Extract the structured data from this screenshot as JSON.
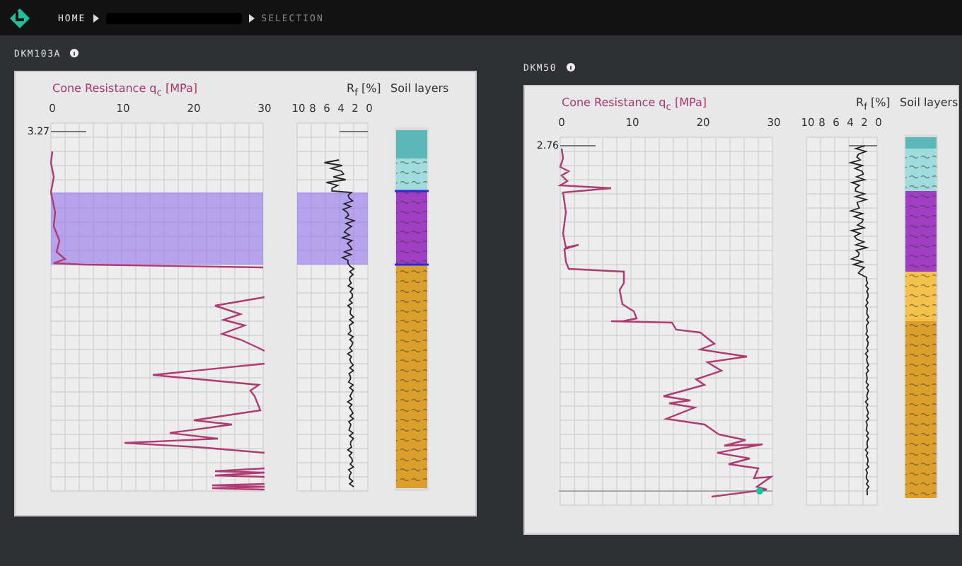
{
  "header": {
    "breadcrumbs": [
      {
        "kind": "link",
        "label": "HOME"
      },
      {
        "kind": "redacted"
      },
      {
        "kind": "current",
        "label": "SELECTION"
      }
    ]
  },
  "panels": [
    {
      "name": "DKM103A",
      "qc_title": "Cone Resistance q$_{c}$ [MPa]",
      "qc_ticks": [
        "0",
        "10",
        "20",
        "30"
      ],
      "rf_title": "R$_{f}$ [%]",
      "rf_ticks": [
        "10",
        "8",
        "6",
        "4",
        "2",
        "0"
      ],
      "soil_title": "Soil layers",
      "depth": "3.27",
      "highlighted": true,
      "cursor": false,
      "layers": [
        {
          "color": "#5cb8b8",
          "patterned": false
        },
        {
          "color": "#9fdcdc",
          "patterned": true
        },
        {
          "color": "#a13fc4",
          "patterned": true
        },
        {
          "color": "#dba02c",
          "patterned": true
        }
      ]
    },
    {
      "name": "DKM50",
      "qc_title": "Cone Resistance q$_{c}$ [MPa]",
      "qc_ticks": [
        "0",
        "10",
        "20",
        "30"
      ],
      "rf_title": "R$_{f}$ [%]",
      "rf_ticks": [
        "10",
        "8",
        "6",
        "4",
        "2",
        "0"
      ],
      "soil_title": "Soil layers",
      "depth": "2.76",
      "highlighted": false,
      "cursor": true,
      "layers": [
        {
          "color": "#5cb8b8",
          "patterned": false
        },
        {
          "color": "#9fdcdc",
          "patterned": true
        },
        {
          "color": "#a13fc4",
          "patterned": true
        },
        {
          "color": "#f3c24a",
          "patterned": true
        },
        {
          "color": "#dba02c",
          "patterned": true
        }
      ]
    }
  ]
}
